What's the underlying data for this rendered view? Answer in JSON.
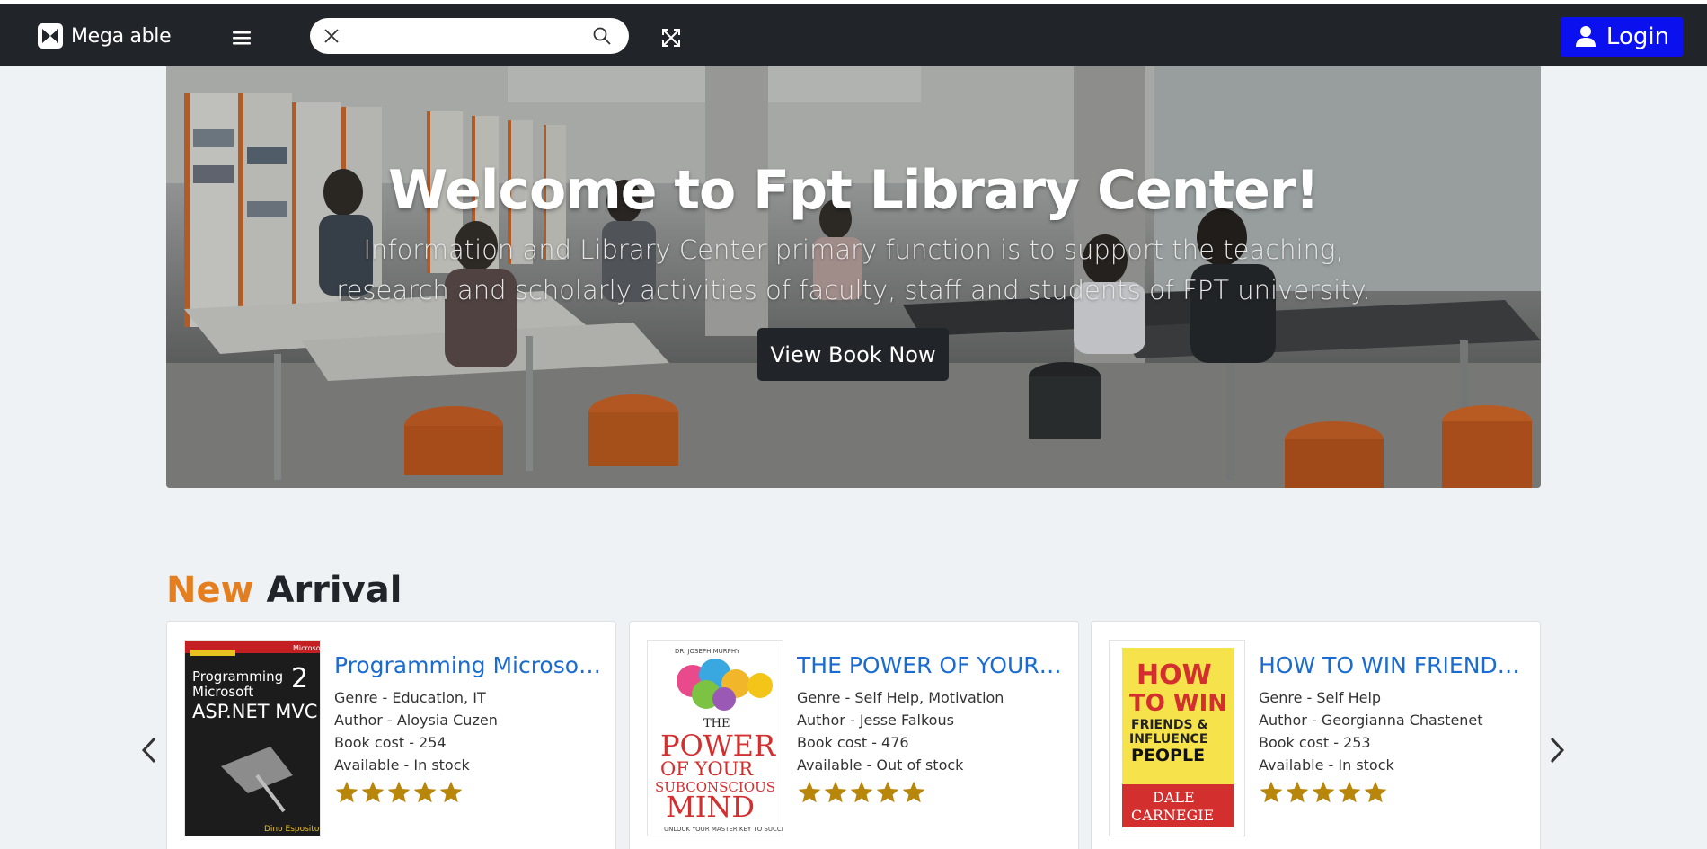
{
  "navbar": {
    "brand": "Mega able",
    "search_placeholder": "",
    "login_label": "Login"
  },
  "hero": {
    "title": "Welcome to Fpt Library Center!",
    "subtitle": "Information and Library Center primary function is to support the teaching, research and scholarly activities of faculty, staff and students of FPT university.",
    "button_label": "View Book Now"
  },
  "section": {
    "title_accent": "New",
    "title_rest": "Arrival"
  },
  "books": [
    {
      "title": "Programming Microsoft...",
      "genre": "Genre - Education, IT",
      "author": "Author - Aloysia Cuzen",
      "cost": "Book cost - 254",
      "available": "Available - In stock",
      "rating": 5,
      "cover": {
        "line1": "Programming",
        "line2": "Microsoft",
        "line3": "ASP.NET MVC",
        "edition": "2",
        "publisher": "Microsoft",
        "author": "Dino Esposito"
      }
    },
    {
      "title": "THE POWER OF YOUR S...",
      "genre": "Genre - Self Help, Motivation",
      "author": "Author - Jesse Falkous",
      "cost": "Book cost - 476",
      "available": "Available - Out of stock",
      "rating": 5,
      "cover": {
        "top": "DR. JOSEPH MURPHY",
        "line1": "THE",
        "line2": "POWER",
        "line3": "OF YOUR",
        "line4": "SUBCONSCIOUS",
        "line5": "MIND",
        "bottom": "UNLOCK YOUR MASTER KEY TO SUCCESS"
      }
    },
    {
      "title": "HOW TO WIN FRIENDS ...",
      "genre": "Genre - Self Help",
      "author": "Author - Georgianna Chastenet",
      "cost": "Book cost - 253",
      "available": "Available - In stock",
      "rating": 5,
      "cover": {
        "line1": "HOW",
        "line2": "TO WIN",
        "line3": "FRIENDS &",
        "line4": "INFLUENCE",
        "line5": "PEOPLE",
        "author1": "DALE",
        "author2": "CARNEGIE"
      }
    }
  ],
  "colors": {
    "navbar_bg": "#212529",
    "login_bg": "#0a11ee",
    "accent_orange": "#e57e1e",
    "link_blue": "#1a6cd1",
    "star_gold": "#b8860b",
    "page_bg": "#eef2f5"
  },
  "icons": [
    "brand-logo-icon",
    "hamburger-menu-icon",
    "close-icon",
    "search-icon",
    "fullscreen-icon",
    "user-icon",
    "chevron-left-icon",
    "chevron-right-icon",
    "star-icon"
  ]
}
